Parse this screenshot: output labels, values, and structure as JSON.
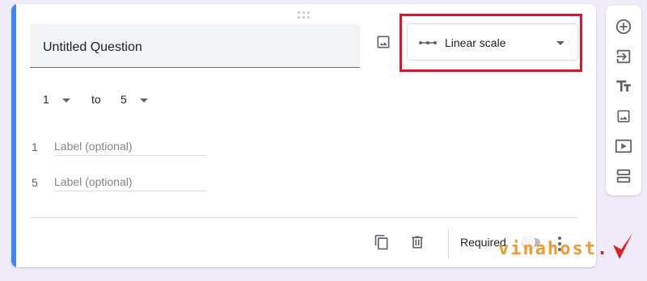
{
  "question": {
    "title": "Untitled Question",
    "type_label": "Linear scale"
  },
  "scale": {
    "from_value": "1",
    "to_word": "to",
    "to_value": "5"
  },
  "labels": [
    {
      "number": "1",
      "placeholder": "Label (optional)"
    },
    {
      "number": "5",
      "placeholder": "Label (optional)"
    }
  ],
  "footer": {
    "required_label": "Required",
    "required_on": false
  },
  "toolbar": {
    "items": [
      "add-question-icon",
      "import-questions-icon",
      "add-title-icon",
      "add-image-icon",
      "add-video-icon",
      "add-section-icon"
    ]
  },
  "watermark": {
    "text_a": "vina",
    "text_b": "host",
    "text_c": "."
  },
  "colors": {
    "accent": "#4285f4",
    "highlight": "#e4112a",
    "background": "#f0ebf8"
  }
}
